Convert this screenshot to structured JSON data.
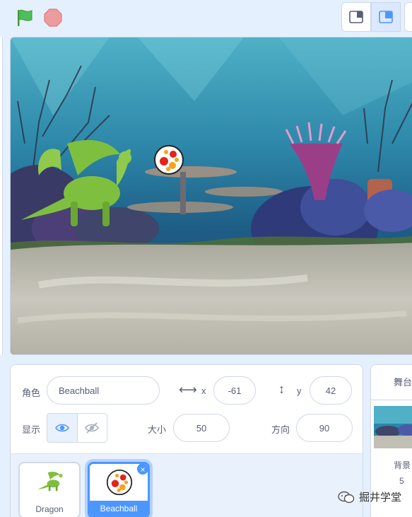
{
  "toolbar": {
    "green_flag_icon": "green-flag-icon",
    "stop_icon": "stop-sign-icon",
    "colors": {
      "flag": "#31b544",
      "stop": "#ec9c9c"
    }
  },
  "sprite_info": {
    "sprite_label": "角色",
    "sprite_name": "Beachball",
    "x_label": "x",
    "x_value": "-61",
    "y_label": "y",
    "y_value": "42",
    "show_label": "显示",
    "size_label": "大小",
    "size_value": "50",
    "direction_label": "方向",
    "direction_value": "90"
  },
  "sprites": [
    {
      "name": "Dragon",
      "selected": false
    },
    {
      "name": "Beachball",
      "selected": true
    }
  ],
  "stage_panel": {
    "title": "舞台",
    "backdrops_label": "背景",
    "backdrop_count": "5"
  },
  "watermark": {
    "text": "掘井学堂"
  },
  "colors": {
    "accent": "#4c97ff",
    "background": "#e5f0ff",
    "border": "#d0d7e6"
  }
}
